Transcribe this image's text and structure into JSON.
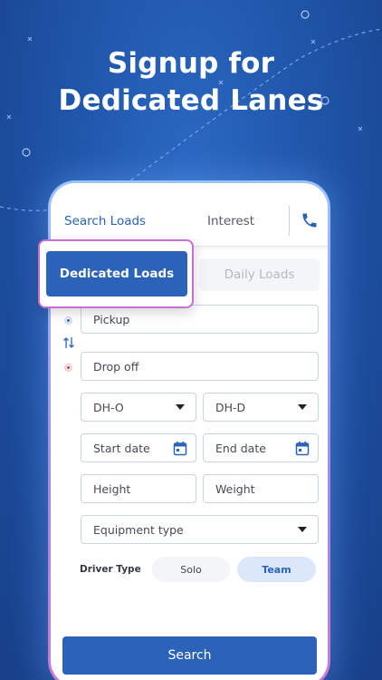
{
  "headline": {
    "line1": "Signup for",
    "line2": "Dedicated Lanes"
  },
  "topbar": {
    "search_loads": "Search Loads",
    "interest": "Interest",
    "phone_icon": "phone-icon"
  },
  "mode_tabs": {
    "dedicated": "Dedicated Loads",
    "daily": "Daily Loads"
  },
  "form": {
    "pickup_placeholder": "Pickup",
    "dropoff_placeholder": "Drop off",
    "dh_o": "DH-O",
    "dh_d": "DH-D",
    "start_date": "Start date",
    "end_date": "End date",
    "height": "Height",
    "weight": "Weight",
    "equipment_type": "Equipment type"
  },
  "driver_type": {
    "label": "Driver Type",
    "solo": "Solo",
    "team": "Team",
    "selected": "Team"
  },
  "search_button": "Search",
  "colors": {
    "brand": "#2a63b8",
    "background": "#1f4e9e",
    "accent_border": "#c86fd0"
  }
}
